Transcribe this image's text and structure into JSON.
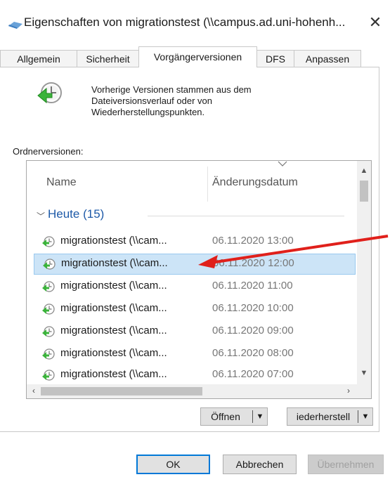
{
  "window": {
    "title": "Eigenschaften von migrationstest (\\\\campus.ad.uni-hohenh...",
    "close_glyph": "✕"
  },
  "tabs": [
    {
      "label": "Allgemein",
      "active": false
    },
    {
      "label": "Sicherheit",
      "active": false
    },
    {
      "label": "Vorgängerversionen",
      "active": true
    },
    {
      "label": "DFS",
      "active": false
    },
    {
      "label": "Anpassen",
      "active": false
    }
  ],
  "info": {
    "icon": "restore-clock-icon",
    "line1": "Vorherige Versionen stammen aus dem",
    "line2": "Dateiversionsverlauf oder von",
    "line3": "Wiederherstellungspunkten."
  },
  "section_label": "Ordnerversionen:",
  "list": {
    "columns": {
      "name": "Name",
      "date": "Änderungsdatum"
    },
    "group": {
      "label": "Heute (15)",
      "expanded": true
    },
    "rows": [
      {
        "name": "migrationstest (\\\\cam...",
        "date": "06.11.2020 13:00",
        "selected": false
      },
      {
        "name": "migrationstest (\\\\cam...",
        "date": "06.11.2020 12:00",
        "selected": true
      },
      {
        "name": "migrationstest (\\\\cam...",
        "date": "06.11.2020 11:00",
        "selected": false
      },
      {
        "name": "migrationstest (\\\\cam...",
        "date": "06.11.2020 10:00",
        "selected": false
      },
      {
        "name": "migrationstest (\\\\cam...",
        "date": "06.11.2020 09:00",
        "selected": false
      },
      {
        "name": "migrationstest (\\\\cam...",
        "date": "06.11.2020 08:00",
        "selected": false
      },
      {
        "name": "migrationstest (\\\\cam...",
        "date": "06.11.2020 07:00",
        "selected": false
      }
    ]
  },
  "actions": {
    "open_label": "Öffnen",
    "restore_label": "iederherstell",
    "dropdown_glyph": "▼"
  },
  "buttons": {
    "ok": "OK",
    "cancel": "Abbrechen",
    "apply": "Übernehmen"
  },
  "colors": {
    "selection": "#cce4f7",
    "accent": "#0078d7",
    "group_label": "#1e5aa8",
    "annotation_arrow": "#e0201b"
  }
}
